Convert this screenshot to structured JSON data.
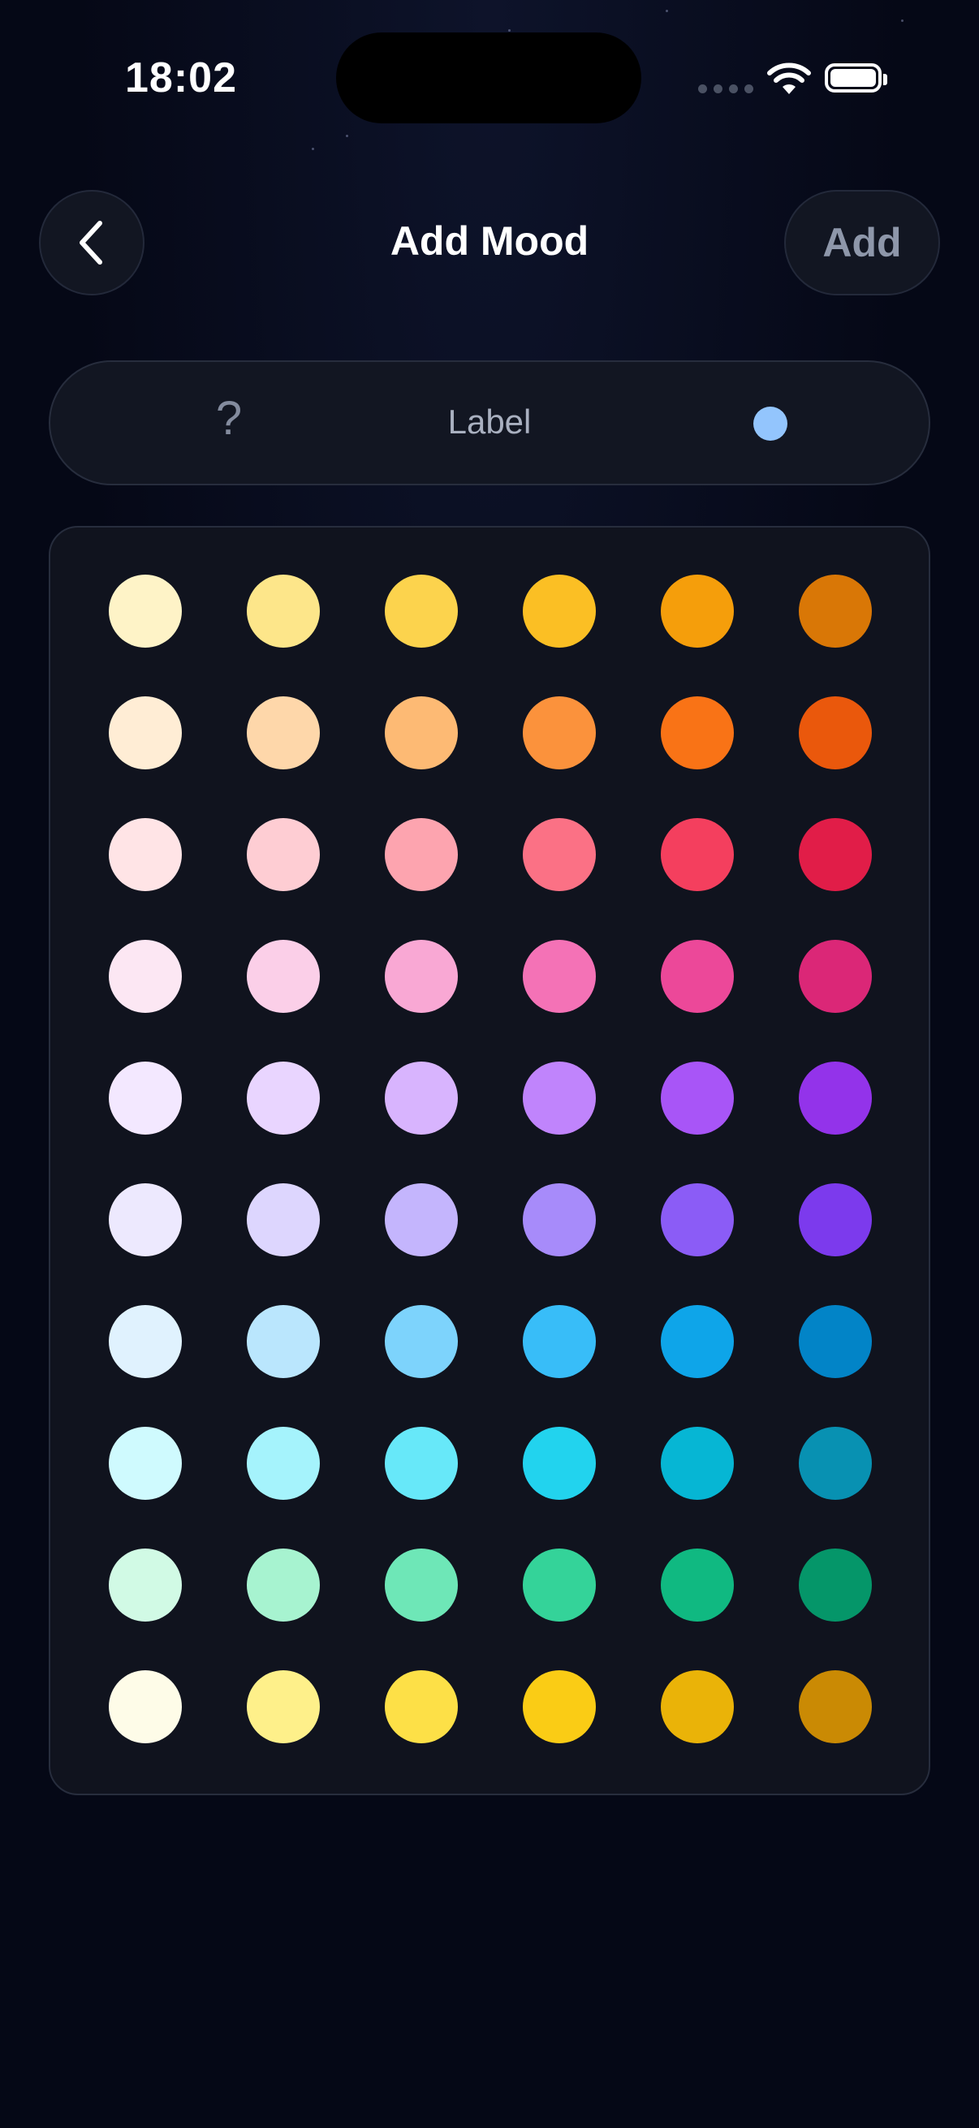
{
  "status_bar": {
    "time": "18:02",
    "icons": [
      "cellular-icon",
      "wifi-icon",
      "battery-icon"
    ]
  },
  "header": {
    "back_icon": "chevron-left-icon",
    "title": "Add Mood",
    "add_label": "Add"
  },
  "preview": {
    "emoji_placeholder": "?",
    "label_placeholder": "Label",
    "selected_color": "#93c5fd"
  },
  "palette": {
    "rows": [
      [
        "#fef3c7",
        "#fde68a",
        "#fcd34d",
        "#fbbf24",
        "#f59e0b",
        "#d97706"
      ],
      [
        "#ffedd5",
        "#fed7aa",
        "#fdba74",
        "#fb923c",
        "#f97316",
        "#ea580c"
      ],
      [
        "#ffe4e6",
        "#fecdd3",
        "#fda4af",
        "#fb7185",
        "#f43f5e",
        "#e11d48"
      ],
      [
        "#fce7f3",
        "#fbcfe8",
        "#f9a8d4",
        "#f472b6",
        "#ec4899",
        "#db2777"
      ],
      [
        "#f3e8ff",
        "#e9d5ff",
        "#d8b4fe",
        "#c084fc",
        "#a855f7",
        "#9333ea"
      ],
      [
        "#ede9fe",
        "#ddd6fe",
        "#c4b5fd",
        "#a78bfa",
        "#8b5cf6",
        "#7c3aed"
      ],
      [
        "#e0f2fe",
        "#bae6fd",
        "#7dd3fc",
        "#38bdf8",
        "#0ea5e9",
        "#0284c7"
      ],
      [
        "#cffafe",
        "#a5f3fc",
        "#67e8f9",
        "#22d3ee",
        "#06b6d4",
        "#0891b2"
      ],
      [
        "#d1fae5",
        "#a7f3d0",
        "#6ee7b7",
        "#34d399",
        "#10b981",
        "#059669"
      ],
      [
        "#fefce8",
        "#fef08a",
        "#fde047",
        "#facc15",
        "#eab308",
        "#ca8a04"
      ]
    ]
  }
}
